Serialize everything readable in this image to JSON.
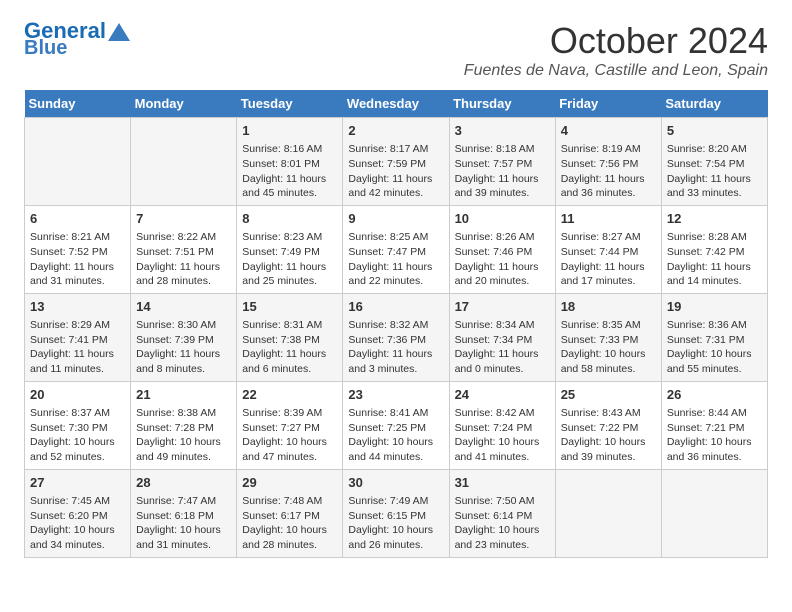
{
  "header": {
    "logo_line1": "General",
    "logo_line2": "Blue",
    "month_title": "October 2024",
    "location": "Fuentes de Nava, Castille and Leon, Spain"
  },
  "weekdays": [
    "Sunday",
    "Monday",
    "Tuesday",
    "Wednesday",
    "Thursday",
    "Friday",
    "Saturday"
  ],
  "weeks": [
    [
      {
        "day": "",
        "info": ""
      },
      {
        "day": "",
        "info": ""
      },
      {
        "day": "1",
        "info": "Sunrise: 8:16 AM\nSunset: 8:01 PM\nDaylight: 11 hours and 45 minutes."
      },
      {
        "day": "2",
        "info": "Sunrise: 8:17 AM\nSunset: 7:59 PM\nDaylight: 11 hours and 42 minutes."
      },
      {
        "day": "3",
        "info": "Sunrise: 8:18 AM\nSunset: 7:57 PM\nDaylight: 11 hours and 39 minutes."
      },
      {
        "day": "4",
        "info": "Sunrise: 8:19 AM\nSunset: 7:56 PM\nDaylight: 11 hours and 36 minutes."
      },
      {
        "day": "5",
        "info": "Sunrise: 8:20 AM\nSunset: 7:54 PM\nDaylight: 11 hours and 33 minutes."
      }
    ],
    [
      {
        "day": "6",
        "info": "Sunrise: 8:21 AM\nSunset: 7:52 PM\nDaylight: 11 hours and 31 minutes."
      },
      {
        "day": "7",
        "info": "Sunrise: 8:22 AM\nSunset: 7:51 PM\nDaylight: 11 hours and 28 minutes."
      },
      {
        "day": "8",
        "info": "Sunrise: 8:23 AM\nSunset: 7:49 PM\nDaylight: 11 hours and 25 minutes."
      },
      {
        "day": "9",
        "info": "Sunrise: 8:25 AM\nSunset: 7:47 PM\nDaylight: 11 hours and 22 minutes."
      },
      {
        "day": "10",
        "info": "Sunrise: 8:26 AM\nSunset: 7:46 PM\nDaylight: 11 hours and 20 minutes."
      },
      {
        "day": "11",
        "info": "Sunrise: 8:27 AM\nSunset: 7:44 PM\nDaylight: 11 hours and 17 minutes."
      },
      {
        "day": "12",
        "info": "Sunrise: 8:28 AM\nSunset: 7:42 PM\nDaylight: 11 hours and 14 minutes."
      }
    ],
    [
      {
        "day": "13",
        "info": "Sunrise: 8:29 AM\nSunset: 7:41 PM\nDaylight: 11 hours and 11 minutes."
      },
      {
        "day": "14",
        "info": "Sunrise: 8:30 AM\nSunset: 7:39 PM\nDaylight: 11 hours and 8 minutes."
      },
      {
        "day": "15",
        "info": "Sunrise: 8:31 AM\nSunset: 7:38 PM\nDaylight: 11 hours and 6 minutes."
      },
      {
        "day": "16",
        "info": "Sunrise: 8:32 AM\nSunset: 7:36 PM\nDaylight: 11 hours and 3 minutes."
      },
      {
        "day": "17",
        "info": "Sunrise: 8:34 AM\nSunset: 7:34 PM\nDaylight: 11 hours and 0 minutes."
      },
      {
        "day": "18",
        "info": "Sunrise: 8:35 AM\nSunset: 7:33 PM\nDaylight: 10 hours and 58 minutes."
      },
      {
        "day": "19",
        "info": "Sunrise: 8:36 AM\nSunset: 7:31 PM\nDaylight: 10 hours and 55 minutes."
      }
    ],
    [
      {
        "day": "20",
        "info": "Sunrise: 8:37 AM\nSunset: 7:30 PM\nDaylight: 10 hours and 52 minutes."
      },
      {
        "day": "21",
        "info": "Sunrise: 8:38 AM\nSunset: 7:28 PM\nDaylight: 10 hours and 49 minutes."
      },
      {
        "day": "22",
        "info": "Sunrise: 8:39 AM\nSunset: 7:27 PM\nDaylight: 10 hours and 47 minutes."
      },
      {
        "day": "23",
        "info": "Sunrise: 8:41 AM\nSunset: 7:25 PM\nDaylight: 10 hours and 44 minutes."
      },
      {
        "day": "24",
        "info": "Sunrise: 8:42 AM\nSunset: 7:24 PM\nDaylight: 10 hours and 41 minutes."
      },
      {
        "day": "25",
        "info": "Sunrise: 8:43 AM\nSunset: 7:22 PM\nDaylight: 10 hours and 39 minutes."
      },
      {
        "day": "26",
        "info": "Sunrise: 8:44 AM\nSunset: 7:21 PM\nDaylight: 10 hours and 36 minutes."
      }
    ],
    [
      {
        "day": "27",
        "info": "Sunrise: 7:45 AM\nSunset: 6:20 PM\nDaylight: 10 hours and 34 minutes."
      },
      {
        "day": "28",
        "info": "Sunrise: 7:47 AM\nSunset: 6:18 PM\nDaylight: 10 hours and 31 minutes."
      },
      {
        "day": "29",
        "info": "Sunrise: 7:48 AM\nSunset: 6:17 PM\nDaylight: 10 hours and 28 minutes."
      },
      {
        "day": "30",
        "info": "Sunrise: 7:49 AM\nSunset: 6:15 PM\nDaylight: 10 hours and 26 minutes."
      },
      {
        "day": "31",
        "info": "Sunrise: 7:50 AM\nSunset: 6:14 PM\nDaylight: 10 hours and 23 minutes."
      },
      {
        "day": "",
        "info": ""
      },
      {
        "day": "",
        "info": ""
      }
    ]
  ]
}
